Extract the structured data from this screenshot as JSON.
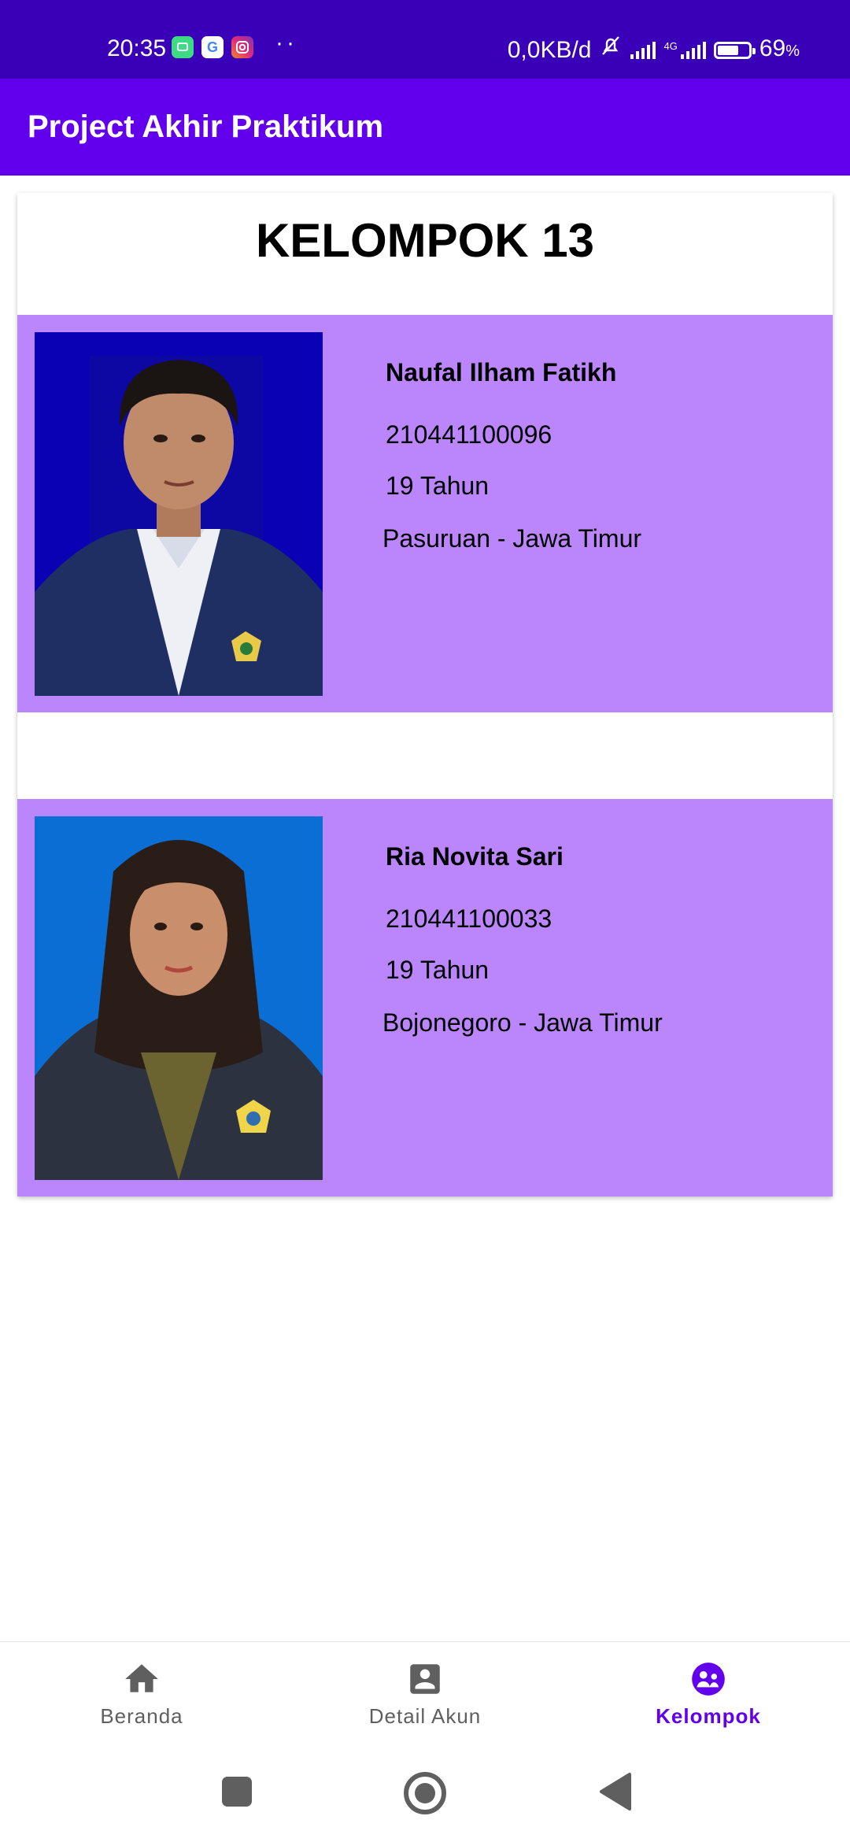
{
  "status_bar": {
    "time": "20:35",
    "network_speed": "0,0KB/d",
    "battery": "69",
    "battery_unit": "%",
    "network_type": "4G",
    "more_indicator": "··",
    "battery_level": 0.69
  },
  "app_bar": {
    "title": "Project Akhir Praktikum"
  },
  "card": {
    "heading": "KELOMPOK 13",
    "members": [
      {
        "name": "Naufal Ilham Fatikh",
        "nim": "210441100096",
        "age": "19 Tahun",
        "city": "Pasuruan - Jawa Timur"
      },
      {
        "name": "Ria Novita Sari",
        "nim": "210441100033",
        "age": "19 Tahun",
        "city": "Bojonegoro - Jawa Timur"
      }
    ]
  },
  "bottom_nav": {
    "items": [
      {
        "label": "Beranda",
        "icon": "home-icon",
        "active": false
      },
      {
        "label": "Detail Akun",
        "icon": "account-box-icon",
        "active": false
      },
      {
        "label": "Kelompok",
        "icon": "group-icon",
        "active": true
      }
    ]
  },
  "colors": {
    "status_bar": "#3a00b7",
    "app_bar": "#6200ee",
    "member_card": "#bb86fc",
    "active_nav": "#6200ee"
  }
}
